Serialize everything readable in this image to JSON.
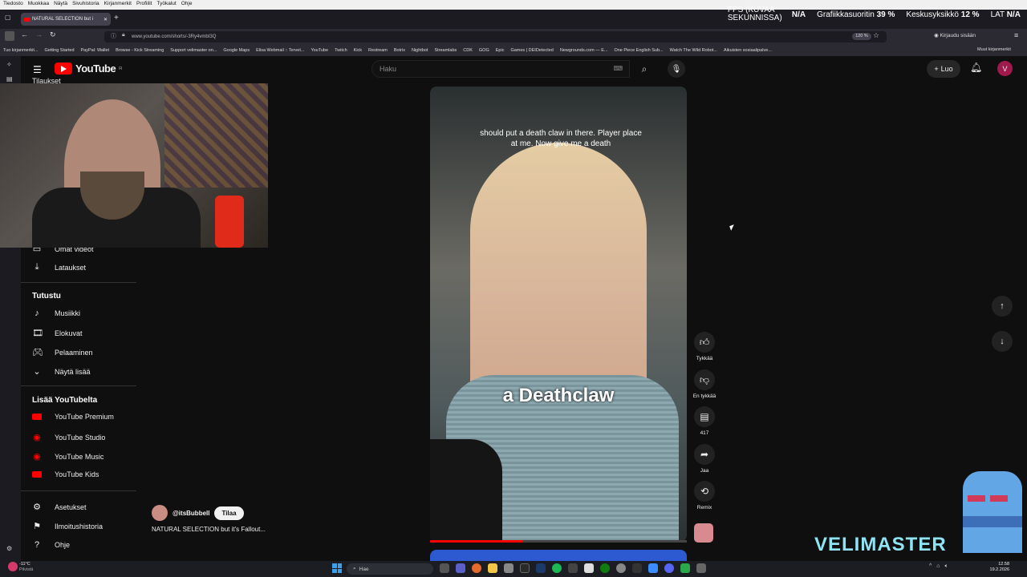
{
  "browser": {
    "menu": [
      "Tiedosto",
      "Muokkaa",
      "Näytä",
      "Sivuhistoria",
      "Kirjanmerkit",
      "Profiilit",
      "Työkalut",
      "Ohje"
    ],
    "tab_title": "NATURAL SELECTION but i",
    "url": "www.youtube.com/shorts/-3Ry4vmbI3Q",
    "zoom": "120 %",
    "login": "Kirjaudu sisään",
    "bookmarks": [
      "Tuo kirjanmerkit...",
      "Getting Started",
      "PayPal: Wallet",
      "Browse - Kick Streaming",
      "Support velimaster on...",
      "Google Maps",
      "Elisa Webmail :: Tervet...",
      "YouTube",
      "Twitch",
      "Kick",
      "Restream",
      "Botrix",
      "Nightbot",
      "Streamlabs",
      "CDK",
      "GOG",
      "Epic",
      "Games | DEIDetected",
      "Newgrounds.com — E...",
      "One Piece English Sub...",
      "Watch The Wild Robot...",
      "Aikuisten sosiaalipalve..."
    ],
    "other_bookmarks": "Muut kirjanmerkit"
  },
  "overlay_stats": {
    "fps_label": "FPS (KUVAA SEKUNNISSA)",
    "fps_value": "N/A",
    "gpu_label": "Grafiikkasuoritin",
    "gpu_value": "39 %",
    "cpu_label": "Keskusyksikkö",
    "cpu_value": "12 %",
    "lat_label": "LAT",
    "lat_value": "N/A"
  },
  "youtube": {
    "logo": "YouTube",
    "region": "FI",
    "search_placeholder": "Haku",
    "create_label": "Luo",
    "avatar_letter": "V"
  },
  "sidebar": {
    "top_partial": "Tilaukset",
    "partial_item": "Omat videot",
    "downloads": "Lataukset",
    "explore_heading": "Tutustu",
    "explore": [
      "Musiikki",
      "Elokuvat",
      "Pelaaminen",
      "Näytä lisää"
    ],
    "more_heading": "Lisää YouTubelta",
    "more": [
      "YouTube Premium",
      "YouTube Studio",
      "YouTube Music",
      "YouTube Kids"
    ],
    "bottom": [
      "Asetukset",
      "Ilmoitushistoria",
      "Ohje"
    ]
  },
  "video": {
    "caption_top": "should put a death claw in there. Player place at me. Now give me a death",
    "caption_big": "a Deathclaw",
    "progress": 0.36
  },
  "actions": {
    "like": "Tykkää",
    "dislike": "En tykkää",
    "comments": "417",
    "share": "Jaa",
    "remix": "Remix"
  },
  "channel": {
    "handle": "@itsBubbell",
    "subscribe": "Tilaa",
    "title": "NATURAL SELECTION but it's Fallout..."
  },
  "watermark": "VELIMASTER",
  "taskbar": {
    "weather_temp": "-11°C",
    "weather_desc": "Pilvistä",
    "search": "Hae",
    "time": "12.58",
    "date": "19.2.2026"
  },
  "colors": {
    "yt_red": "#ff0000",
    "accent_cyan": "#8fe3f3"
  }
}
